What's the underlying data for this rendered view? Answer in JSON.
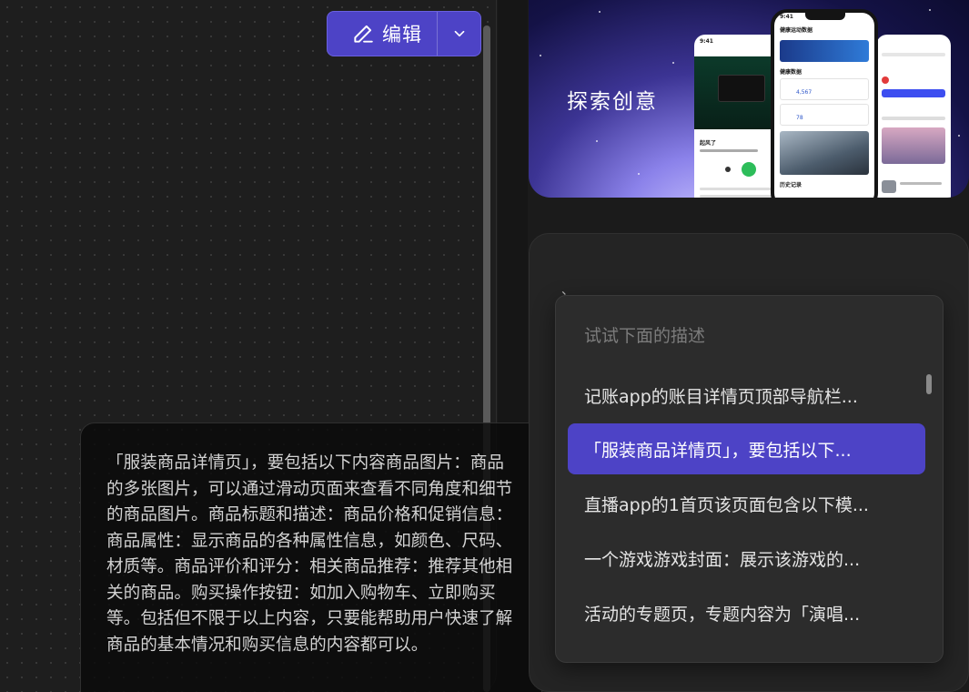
{
  "toolbar": {
    "edit_label": "编辑",
    "edit_icon": "pencil-icon",
    "dropdown_icon": "chevron-down-icon",
    "accent_color": "#4d43c6"
  },
  "prompt_card": {
    "text": "「服装商品详情页」，要包括以下内容商品图片：商品的多张图片，可以通过滑动页面来查看不同角度和细节的商品图片。商品标题和描述：商品价格和促销信息：商品属性：显示商品的各种属性信息，如颜色、尺码、材质等。商品评价和评分：相关商品推荐：推荐其他相关的商品。购买操作按钮：如加入购物车、立即购买等。包括但不限于以上内容，只要能帮助用户快速了解商品的基本情况和购买信息的内容都可以。"
  },
  "banner": {
    "title": "探索创意",
    "left_phone": {
      "time": "9:41",
      "song": "起风了"
    },
    "center_phone": {
      "time": "9:41",
      "header": "健康运动数据",
      "section": "健康数据",
      "steps": "4,567",
      "heart": "78",
      "history": "历史记录"
    }
  },
  "panel": {
    "tick": "、"
  },
  "suggestions": {
    "heading": "试试下面的描述",
    "items": [
      {
        "label": "记账app的账目详情页顶部导航栏...",
        "active": false
      },
      {
        "label": "「服装商品详情页」，要包括以下...",
        "active": true
      },
      {
        "label": "直播app的1首页该页面包含以下模...",
        "active": false
      },
      {
        "label": "一个游戏游戏封面：展示该游戏的...",
        "active": false
      },
      {
        "label": "活动的专题页，专题内容为「演唱...",
        "active": false
      }
    ]
  }
}
